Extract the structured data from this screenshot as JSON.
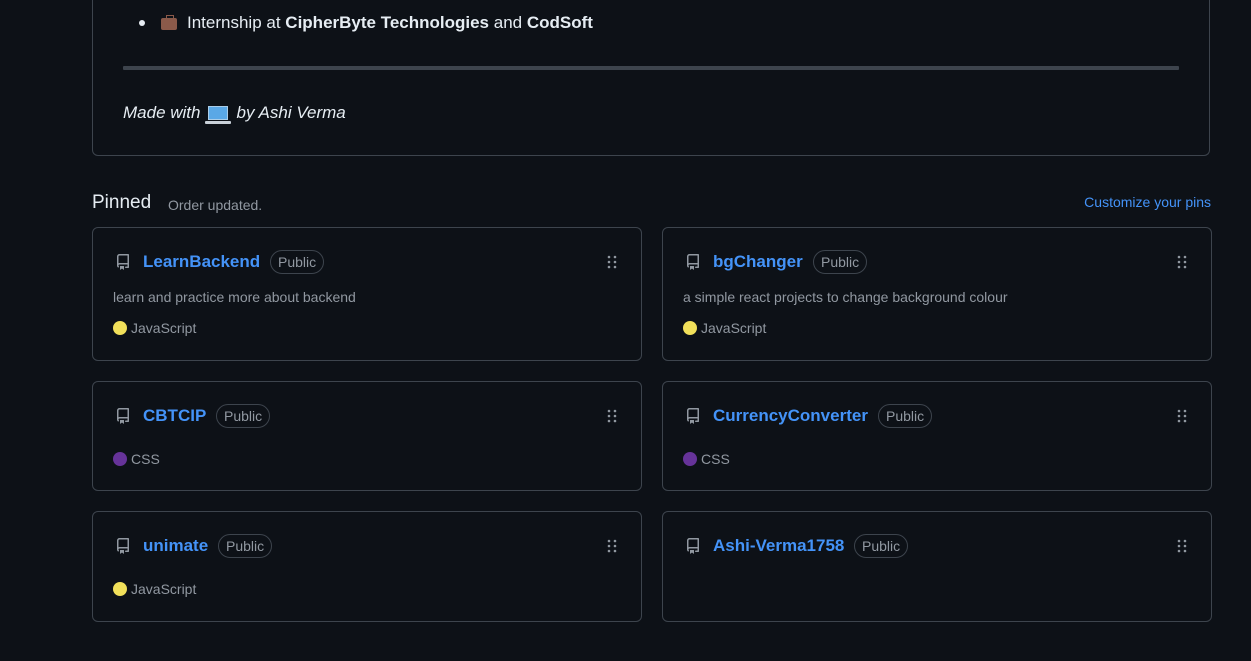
{
  "readme": {
    "bullet_prefix": "Internship at ",
    "bullet_company1": "CipherByte Technologies",
    "bullet_and": " and ",
    "bullet_company2": "CodSoft",
    "made_with_prefix": "Made with",
    "made_with_suffix": "by Ashi Verma",
    "briefcase_icon": "briefcase-emoji",
    "laptop_icon": "laptop-emoji"
  },
  "pinned": {
    "title": "Pinned",
    "status": "Order updated.",
    "customize_label": "Customize your pins",
    "repos": [
      {
        "name": "LearnBackend",
        "visibility": "Public",
        "description": "learn and practice more about backend",
        "language": "JavaScript",
        "language_color": "#f1e05a"
      },
      {
        "name": "bgChanger",
        "visibility": "Public",
        "description": "a simple react projects to change background colour",
        "language": "JavaScript",
        "language_color": "#f1e05a"
      },
      {
        "name": "CBTCIP",
        "visibility": "Public",
        "description": "",
        "language": "CSS",
        "language_color": "#663399"
      },
      {
        "name": "CurrencyConverter",
        "visibility": "Public",
        "description": "",
        "language": "CSS",
        "language_color": "#663399"
      },
      {
        "name": "unimate",
        "visibility": "Public",
        "description": "",
        "language": "JavaScript",
        "language_color": "#f1e05a"
      },
      {
        "name": "Ashi-Verma1758",
        "visibility": "Public",
        "description": "",
        "language": "",
        "language_color": ""
      }
    ]
  },
  "colors": {
    "background": "#0d1117",
    "border": "#3d444d",
    "link": "#4493f8",
    "muted": "#9198a1",
    "text": "#e6edf3"
  }
}
